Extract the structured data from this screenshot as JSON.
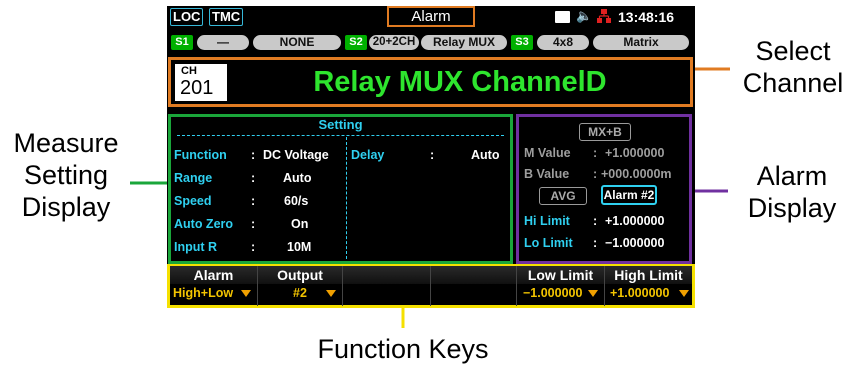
{
  "status_bar": {
    "loc": "LOC",
    "tmc": "TMC",
    "title": "Alarm",
    "time": "13:48:16",
    "icons": [
      "memory-card-icon",
      "speaker-icon",
      "network-icon"
    ]
  },
  "slots": [
    {
      "id": "S1",
      "name": "—",
      "type": "NONE"
    },
    {
      "id": "S2",
      "name": "20+2CH",
      "type": "Relay MUX"
    },
    {
      "id": "S3",
      "name": "4x8",
      "type": "Matrix"
    }
  ],
  "channel": {
    "label": "CH",
    "number": "201",
    "title": "Relay MUX ChannelD"
  },
  "setting": {
    "header": "Setting",
    "rows": [
      {
        "label": "Function",
        "value": "DC Voltage"
      },
      {
        "label": "Range",
        "value": "Auto"
      },
      {
        "label": "Speed",
        "value": "60/s"
      },
      {
        "label": "Auto Zero",
        "value": "On"
      },
      {
        "label": "Input R",
        "value": "10M"
      }
    ],
    "delay": {
      "label": "Delay",
      "value": "Auto"
    }
  },
  "alarm_panel": {
    "mxb": "MX+B",
    "m_value": {
      "label": "M Value",
      "value": "+1.000000"
    },
    "b_value": {
      "label": "B Value",
      "value": "+000.0000m"
    },
    "avg": "AVG",
    "alarm2": "Alarm #2",
    "hi_limit": {
      "label": "Hi Limit",
      "value": "+1.000000"
    },
    "lo_limit": {
      "label": "Lo Limit",
      "value": "−1.000000"
    }
  },
  "function_keys": [
    {
      "top": "Alarm",
      "bottom": "High+Low"
    },
    {
      "top": "Output",
      "bottom": "#2"
    },
    {
      "top": "",
      "bottom": ""
    },
    {
      "top": "",
      "bottom": ""
    },
    {
      "top": "Low Limit",
      "bottom": "−1.000000"
    },
    {
      "top": "High Limit",
      "bottom": "+1.000000"
    }
  ],
  "callouts": {
    "select_channel": [
      "Select",
      "Channel"
    ],
    "measure_setting": [
      "Measure",
      "Setting",
      "Display"
    ],
    "alarm_display": [
      "Alarm",
      "Display"
    ],
    "function_keys": "Function Keys"
  },
  "colors": {
    "orange": "#e07b22",
    "green": "#1aa63a",
    "purple": "#7030a0",
    "yellow": "#f5e000"
  }
}
